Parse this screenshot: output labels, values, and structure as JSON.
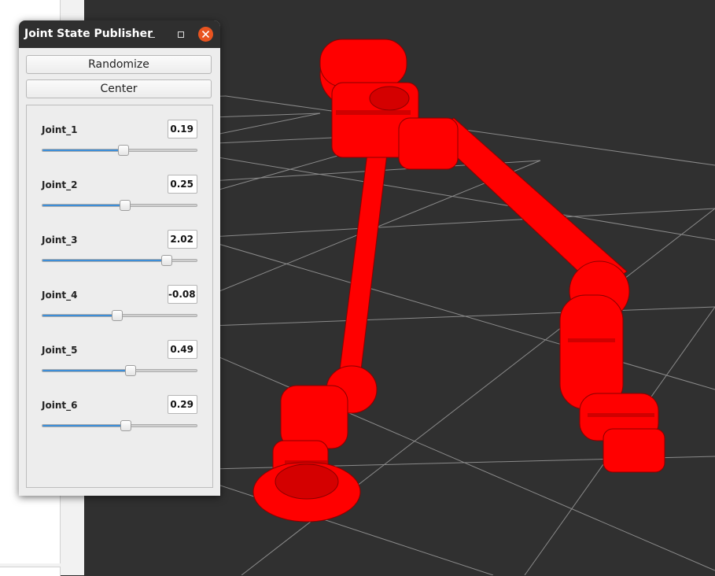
{
  "window": {
    "title": "Joint State Publisher",
    "controls": [
      "minimize",
      "maximize",
      "close"
    ]
  },
  "buttons": {
    "randomize": "Randomize",
    "center": "Center"
  },
  "joints": [
    {
      "label": "Joint_1",
      "value": "0.19",
      "slider_fraction": 0.525
    },
    {
      "label": "Joint_2",
      "value": "0.25",
      "slider_fraction": 0.535
    },
    {
      "label": "Joint_3",
      "value": "2.02",
      "slider_fraction": 0.805
    },
    {
      "label": "Joint_4",
      "value": "-0.08",
      "slider_fraction": 0.485
    },
    {
      "label": "Joint_5",
      "value": "0.49",
      "slider_fraction": 0.57
    },
    {
      "label": "Joint_6",
      "value": "0.29",
      "slider_fraction": 0.54
    }
  ],
  "colors": {
    "viewport_bg": "#303030",
    "grid": "#a0a0a0",
    "robot": "#ff0000",
    "slider_fill": "#3d8ed8",
    "close_button": "#e95420",
    "titlebar": "#2f2f2f"
  }
}
